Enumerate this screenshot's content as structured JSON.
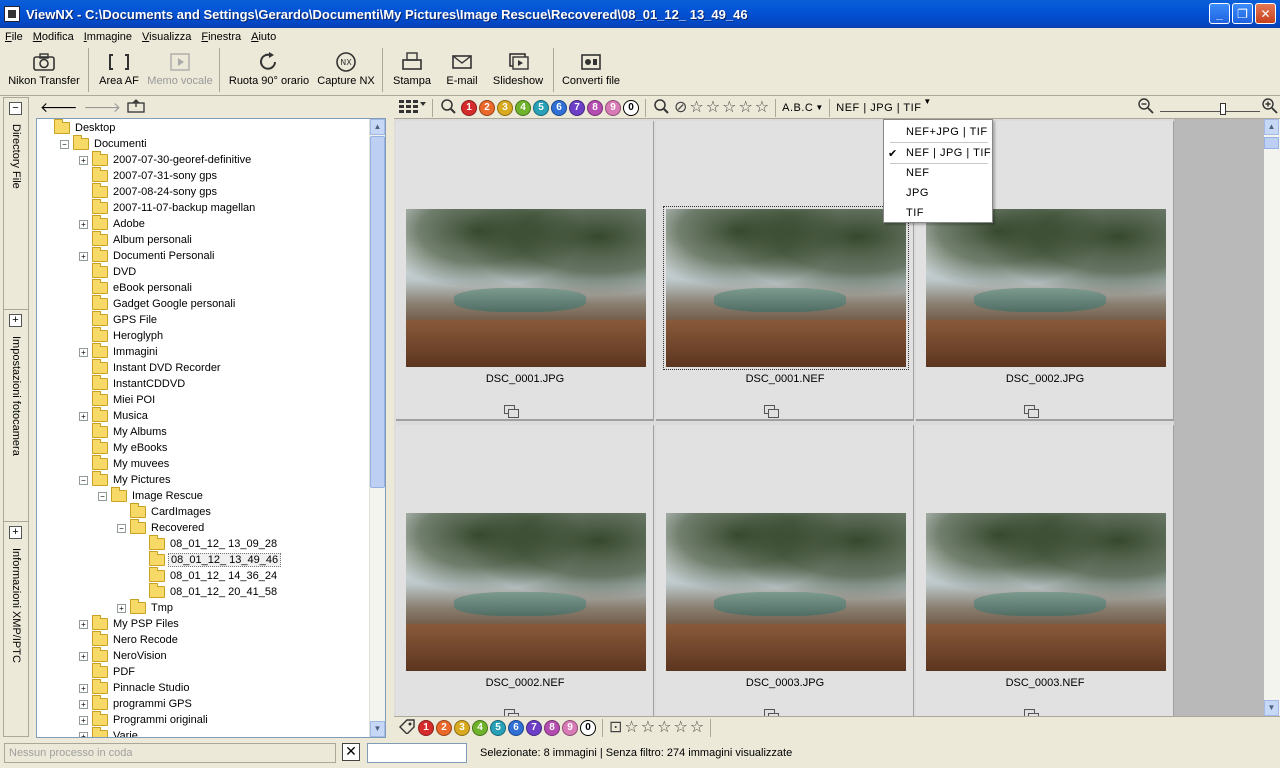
{
  "window": {
    "title": "ViewNX - C:\\Documents and Settings\\Gerardo\\Documenti\\My Pictures\\Image Rescue\\Recovered\\08_01_12_ 13_49_46",
    "minimize": "_",
    "maximize": "❐",
    "close": "✕"
  },
  "menu": [
    "File",
    "Modifica",
    "Immagine",
    "Visualizza",
    "Finestra",
    "Aiuto"
  ],
  "toolbar": {
    "nikon_transfer": "Nikon Transfer",
    "area_af": "Area AF",
    "memo_vocale": "Memo vocale",
    "ruota": "Ruota 90° orario",
    "capture_nx": "Capture NX",
    "stampa": "Stampa",
    "email": "E-mail",
    "slideshow": "Slideshow",
    "converti": "Converti file"
  },
  "side_tabs": {
    "directory": "Directory File",
    "impostazioni": "Impostazioni fotocamera",
    "informazioni": "Informazioni XMP/IPTC"
  },
  "tree": [
    {
      "label": "Desktop",
      "level": 0,
      "exp": ""
    },
    {
      "label": "Documenti",
      "level": 1,
      "exp": "−"
    },
    {
      "label": "2007-07-30-georef-definitive",
      "level": 2,
      "exp": "+"
    },
    {
      "label": "2007-07-31-sony gps",
      "level": 2,
      "exp": ""
    },
    {
      "label": "2007-08-24-sony gps",
      "level": 2,
      "exp": ""
    },
    {
      "label": "2007-11-07-backup magellan",
      "level": 2,
      "exp": ""
    },
    {
      "label": "Adobe",
      "level": 2,
      "exp": "+"
    },
    {
      "label": "Album personali",
      "level": 2,
      "exp": ""
    },
    {
      "label": "Documenti Personali",
      "level": 2,
      "exp": "+"
    },
    {
      "label": "DVD",
      "level": 2,
      "exp": ""
    },
    {
      "label": "eBook personali",
      "level": 2,
      "exp": ""
    },
    {
      "label": "Gadget Google personali",
      "level": 2,
      "exp": ""
    },
    {
      "label": "GPS File",
      "level": 2,
      "exp": ""
    },
    {
      "label": "Heroglyph",
      "level": 2,
      "exp": ""
    },
    {
      "label": "Immagini",
      "level": 2,
      "exp": "+"
    },
    {
      "label": "Instant DVD Recorder",
      "level": 2,
      "exp": ""
    },
    {
      "label": "InstantCDDVD",
      "level": 2,
      "exp": ""
    },
    {
      "label": "Miei POI",
      "level": 2,
      "exp": ""
    },
    {
      "label": "Musica",
      "level": 2,
      "exp": "+"
    },
    {
      "label": "My Albums",
      "level": 2,
      "exp": ""
    },
    {
      "label": "My eBooks",
      "level": 2,
      "exp": ""
    },
    {
      "label": "My muvees",
      "level": 2,
      "exp": ""
    },
    {
      "label": "My Pictures",
      "level": 2,
      "exp": "−"
    },
    {
      "label": "Image Rescue",
      "level": 3,
      "exp": "−"
    },
    {
      "label": "CardImages",
      "level": 4,
      "exp": ""
    },
    {
      "label": "Recovered",
      "level": 4,
      "exp": "−"
    },
    {
      "label": "08_01_12_ 13_09_28",
      "level": 5,
      "exp": ""
    },
    {
      "label": "08_01_12_ 13_49_46",
      "level": 5,
      "exp": "",
      "selected": true
    },
    {
      "label": "08_01_12_ 14_36_24",
      "level": 5,
      "exp": ""
    },
    {
      "label": "08_01_12_ 20_41_58",
      "level": 5,
      "exp": ""
    },
    {
      "label": "Tmp",
      "level": 4,
      "exp": "+"
    },
    {
      "label": "My PSP Files",
      "level": 2,
      "exp": "+"
    },
    {
      "label": "Nero Recode",
      "level": 2,
      "exp": ""
    },
    {
      "label": "NeroVision",
      "level": 2,
      "exp": "+"
    },
    {
      "label": "PDF",
      "level": 2,
      "exp": ""
    },
    {
      "label": "Pinnacle Studio",
      "level": 2,
      "exp": "+"
    },
    {
      "label": "programmi GPS",
      "level": 2,
      "exp": "+"
    },
    {
      "label": "Programmi originali",
      "level": 2,
      "exp": "+"
    },
    {
      "label": "Varie",
      "level": 2,
      "exp": "+"
    }
  ],
  "labels": [
    {
      "n": "1",
      "color": "#d62b2b"
    },
    {
      "n": "2",
      "color": "#e9682a"
    },
    {
      "n": "3",
      "color": "#d9a91f"
    },
    {
      "n": "4",
      "color": "#6fb32d"
    },
    {
      "n": "5",
      "color": "#27a0b8"
    },
    {
      "n": "6",
      "color": "#2f6fd6"
    },
    {
      "n": "7",
      "color": "#6d3fc6"
    },
    {
      "n": "8",
      "color": "#b54cb0"
    },
    {
      "n": "9",
      "color": "#d87ab6"
    },
    {
      "n": "0",
      "color": "#ffffff"
    }
  ],
  "filter": {
    "sort": "A.B.C",
    "format": "NEF | JPG | TIF"
  },
  "format_menu": [
    {
      "label": "NEF+JPG | TIF",
      "checked": false
    },
    {
      "label": "NEF | JPG | TIF",
      "checked": true
    },
    {
      "label": "NEF",
      "checked": false
    },
    {
      "label": "JPG",
      "checked": false
    },
    {
      "label": "TIF",
      "checked": false
    }
  ],
  "check_mark": "✔",
  "thumbnails": [
    {
      "name": "DSC_0001.JPG"
    },
    {
      "name": "DSC_0001.NEF",
      "selected": true
    },
    {
      "name": "DSC_0002.JPG"
    },
    {
      "name": "DSC_0002.NEF"
    },
    {
      "name": "DSC_0003.JPG"
    },
    {
      "name": "DSC_0003.NEF"
    }
  ],
  "status": {
    "queue_placeholder": "Nessun processo in coda",
    "cancel": "✕",
    "selection": "Selezionate: 8 immagini | Senza filtro: 274 immagini visualizzate"
  },
  "zoom_level": 0.64
}
